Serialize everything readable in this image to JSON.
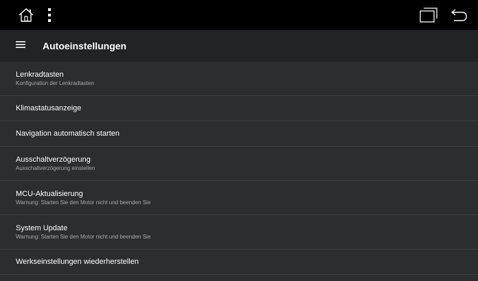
{
  "statusbar": {
    "icons": [
      "home-icon",
      "more-vert-icon",
      "recent-apps-icon",
      "back-icon"
    ],
    "background": "#000000"
  },
  "appbar": {
    "title": "Autoeinstellungen",
    "icon": "hamburger-menu-icon"
  },
  "settings": [
    {
      "title": "Lenkradtasten",
      "subtitle": "Konfiguration der Lenkradtasten"
    },
    {
      "title": "Klimastatusanzeige"
    },
    {
      "title": "Navigation automatisch starten"
    },
    {
      "title": "Ausschaltverzögerung",
      "subtitle": "Ausschaltverzögerung einstellen"
    },
    {
      "title": "MCU-Aktualisierung",
      "subtitle": "Warnung: Starten Sie den Motor nicht und beenden Sie"
    },
    {
      "title": "System Update",
      "subtitle": "Warnung: Starten Sie den Motor nicht und beenden Sie"
    },
    {
      "title": "Werkseinstellungen wiederherstellen"
    }
  ],
  "colors": {
    "list_background": "#2b2d2e",
    "appbar_background": "#212325",
    "divider": "#3d4041",
    "title_text": "#ffffff",
    "subtitle_text": "#a9abad"
  }
}
